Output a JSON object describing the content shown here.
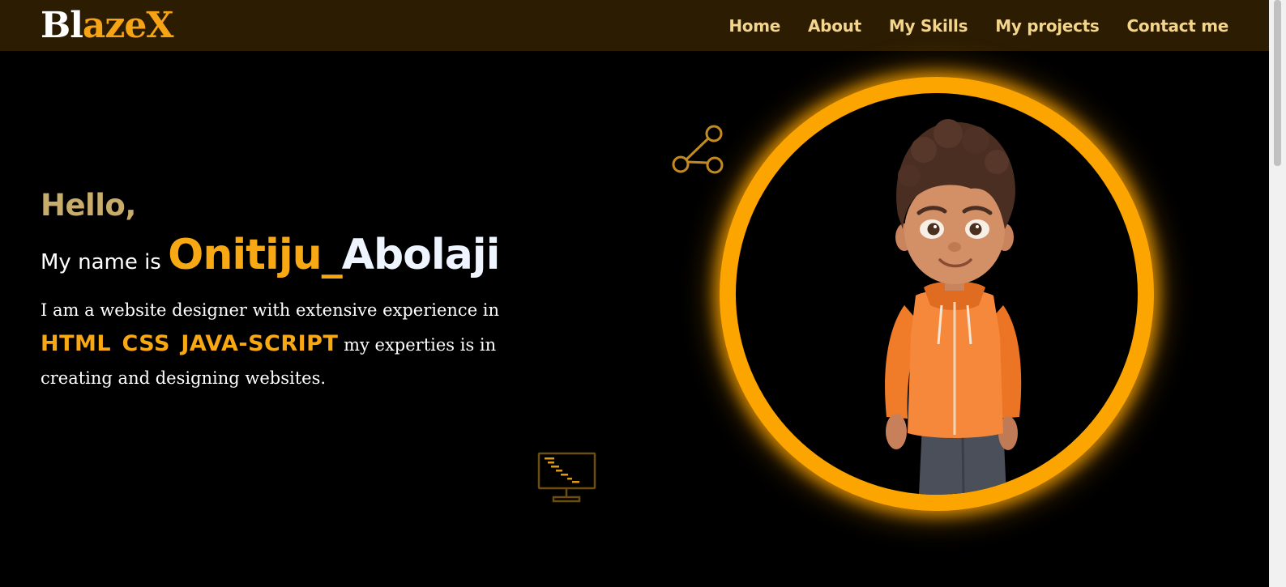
{
  "brand": {
    "logo_part1": "Bl",
    "logo_part2": "azeX"
  },
  "nav": {
    "home": "Home",
    "about": "About",
    "skills": "My Skills",
    "projects": "My projects",
    "contact": "Contact me"
  },
  "hero": {
    "greeting": "Hello,",
    "name_prefix": "My name is",
    "name_first": "Onitiju_",
    "name_last": "Abolaji",
    "bio_part1": "I am a website designer with extensive experience in",
    "skills": [
      "HTML",
      "CSS",
      "JAVA-SCRIPT"
    ],
    "bio_part2": "my experties is in creating and designing websites."
  },
  "icons": {
    "share": "share-icon",
    "monitor": "monitor-code-icon",
    "avatar": "avatar"
  },
  "colors": {
    "accent": "#f8a812",
    "navbar_bg": "#2b1c02",
    "nav_text": "#f3d58d",
    "greeting": "#c8ac6b",
    "ring": "#fca400",
    "background": "#000000"
  }
}
